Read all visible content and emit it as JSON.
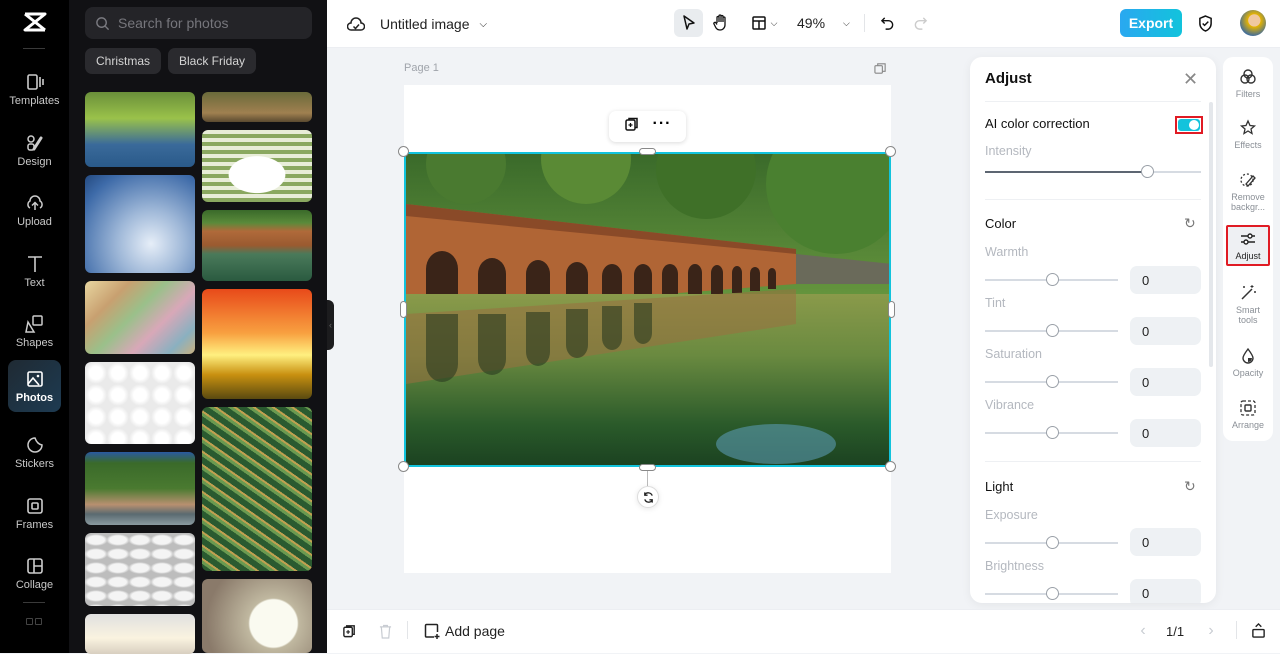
{
  "nav": {
    "items": [
      {
        "label": "Templates",
        "icon": "templates-icon"
      },
      {
        "label": "Design",
        "icon": "design-icon"
      },
      {
        "label": "Upload",
        "icon": "upload-icon"
      },
      {
        "label": "Text",
        "icon": "text-icon"
      },
      {
        "label": "Shapes",
        "icon": "shapes-icon"
      },
      {
        "label": "Photos",
        "icon": "photos-icon",
        "active": true
      },
      {
        "label": "Stickers",
        "icon": "stickers-icon"
      },
      {
        "label": "Frames",
        "icon": "frames-icon"
      },
      {
        "label": "Collage",
        "icon": "collage-icon"
      }
    ]
  },
  "photos_panel": {
    "search_placeholder": "Search for photos",
    "chips": [
      "Christmas",
      "Black Friday"
    ],
    "thumbnails": [
      "pond with reeds",
      "bread slices on plate",
      "winter blue snowflakes",
      "brick arched bridge over water",
      "banknotes",
      "sunset sky over bench",
      "white sphere pattern",
      "green palm leaf",
      "lakeside village",
      "white pills blister",
      "white interior",
      "yogurt jar with spoons"
    ]
  },
  "topbar": {
    "title": "Untitled image",
    "zoom": "49%",
    "export_label": "Export"
  },
  "canvas": {
    "page_label": "Page 1"
  },
  "adjust_panel": {
    "title": "Adjust",
    "ai_color_correction": {
      "label": "AI color correction",
      "enabled": true,
      "intensity_label": "Intensity",
      "intensity": 0.75
    },
    "color": {
      "title": "Color",
      "controls": [
        {
          "label": "Warmth",
          "value": "0"
        },
        {
          "label": "Tint",
          "value": "0"
        },
        {
          "label": "Saturation",
          "value": "0"
        },
        {
          "label": "Vibrance",
          "value": "0"
        }
      ]
    },
    "light": {
      "title": "Light",
      "controls": [
        {
          "label": "Exposure",
          "value": "0"
        },
        {
          "label": "Brightness",
          "value": "0"
        }
      ]
    }
  },
  "right_rail": {
    "items": [
      {
        "label": "Filters"
      },
      {
        "label": "Effects"
      },
      {
        "label": "Remove backgr..."
      },
      {
        "label": "Adjust",
        "active": true
      },
      {
        "label": "Smart tools"
      },
      {
        "label": "Opacity"
      },
      {
        "label": "Arrange"
      }
    ]
  },
  "bottombar": {
    "add_page_label": "Add page",
    "page_counter": "1/1"
  },
  "colors": {
    "accent": "#12c3dc",
    "highlight": "#e01b24"
  }
}
